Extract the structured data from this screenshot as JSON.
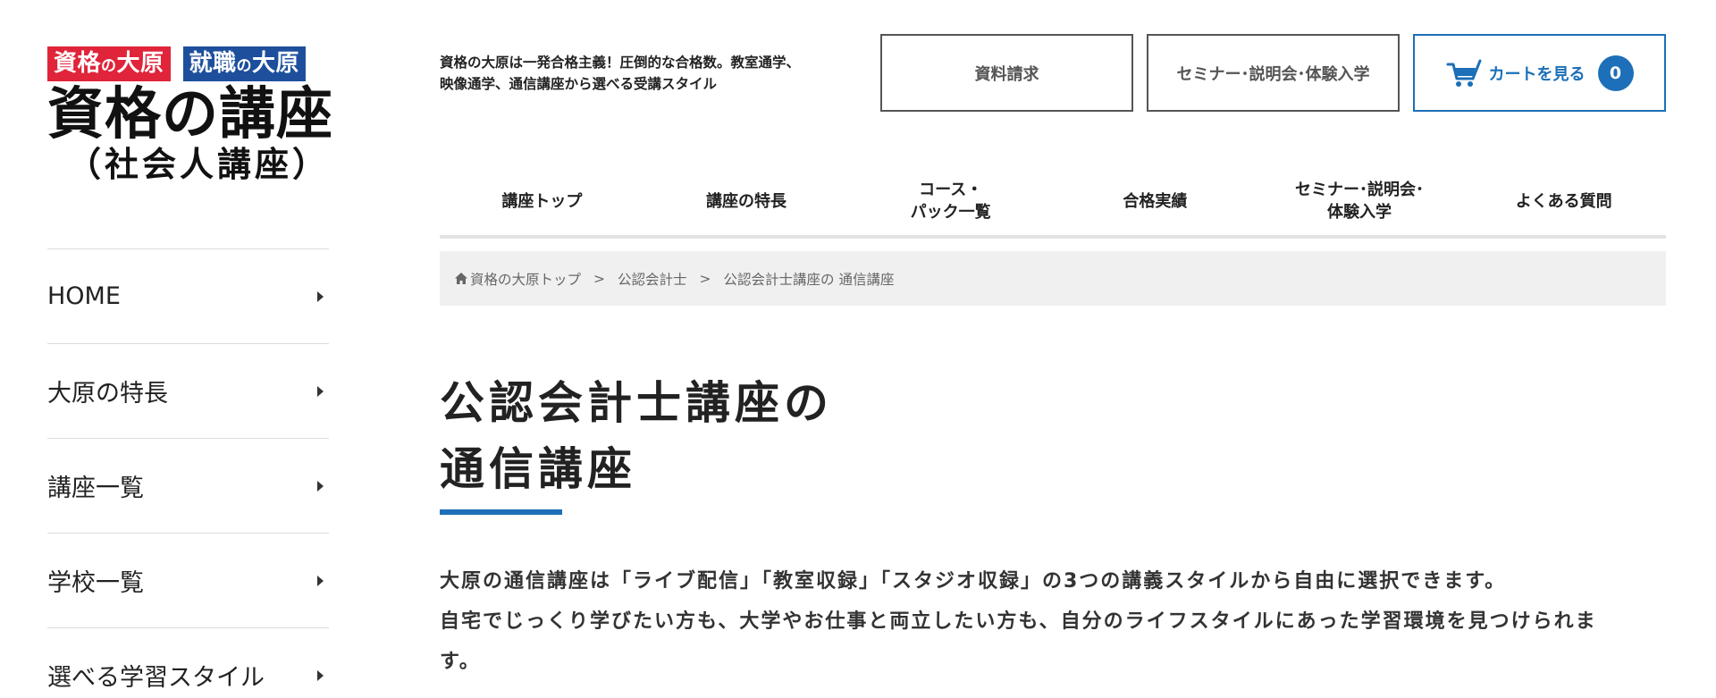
{
  "logo": {
    "badge1_main": "資格",
    "badge1_small": "の",
    "badge1_tail": "大原",
    "badge2_main": "就職",
    "badge2_small": "の",
    "badge2_tail": "大原",
    "title": "資格の講座",
    "subtitle": "（社会人講座）"
  },
  "side_nav": {
    "items": [
      {
        "label": "HOME"
      },
      {
        "label": "大原の特長"
      },
      {
        "label": "講座一覧"
      },
      {
        "label": "学校一覧"
      },
      {
        "label": "選べる学習スタイル"
      }
    ]
  },
  "header": {
    "tagline_line1": "資格の大原は一発合格主義！圧倒的な合格数。教室通学、",
    "tagline_line2": "映像通学、通信講座から選べる受講スタイル",
    "request_label": "資料請求",
    "seminar_label": "セミナー･説明会･体験入学",
    "cart_label": "カートを見る",
    "cart_count": "0"
  },
  "global_nav": {
    "items": [
      {
        "line1": "講座トップ",
        "line2": ""
      },
      {
        "line1": "講座の特長",
        "line2": ""
      },
      {
        "line1": "コース・",
        "line2": "パック一覧"
      },
      {
        "line1": "合格実績",
        "line2": ""
      },
      {
        "line1": "セミナー･説明会･",
        "line2": "体験入学"
      },
      {
        "line1": "よくある質問",
        "line2": ""
      }
    ]
  },
  "breadcrumb": {
    "home": "資格の大原トップ",
    "level2": "公認会計士",
    "current": "公認会計士講座の 通信講座",
    "separator": ">"
  },
  "main": {
    "title_line1": "公認会計士講座の",
    "title_line2": "通信講座",
    "lead_line1": "大原の通信講座は「ライブ配信」「教室収録」「スタジオ収録」の3つの講義スタイルから自由に選択できます。",
    "lead_line2": "自宅でじっくり学びたい方も、大学やお仕事と両立したい方も、自分のライフスタイルにあった学習環境を見つけられま",
    "lead_line3": "す。"
  },
  "colors": {
    "accent_blue": "#1c6fb8",
    "badge_red": "#e0243a",
    "badge_blue": "#1d4f9c"
  },
  "icons": {
    "side_arrow": "caret-right-icon",
    "cart": "cart-icon",
    "home": "home-icon"
  }
}
